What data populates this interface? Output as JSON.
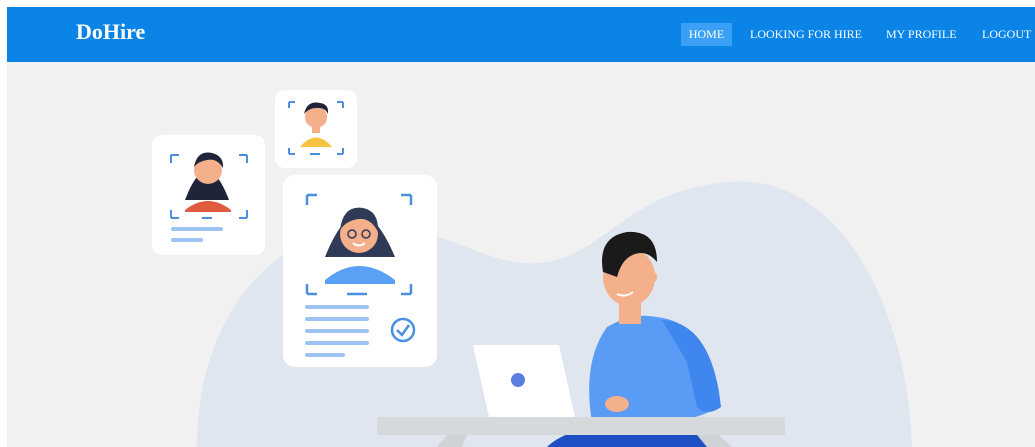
{
  "brand": {
    "name": "DoHire"
  },
  "nav": {
    "home": "HOME",
    "looking_for_hire": "LOOKING FOR HIRE",
    "my_profile": "MY PROFILE",
    "logout": "LOGOUT"
  },
  "colors": {
    "navbar": "#0a84e6",
    "active_tab": "#3aa0f5",
    "page_background": "#f1f1f1"
  },
  "hero": {
    "illustration": "recruiter-reviewing-candidate-profiles"
  }
}
